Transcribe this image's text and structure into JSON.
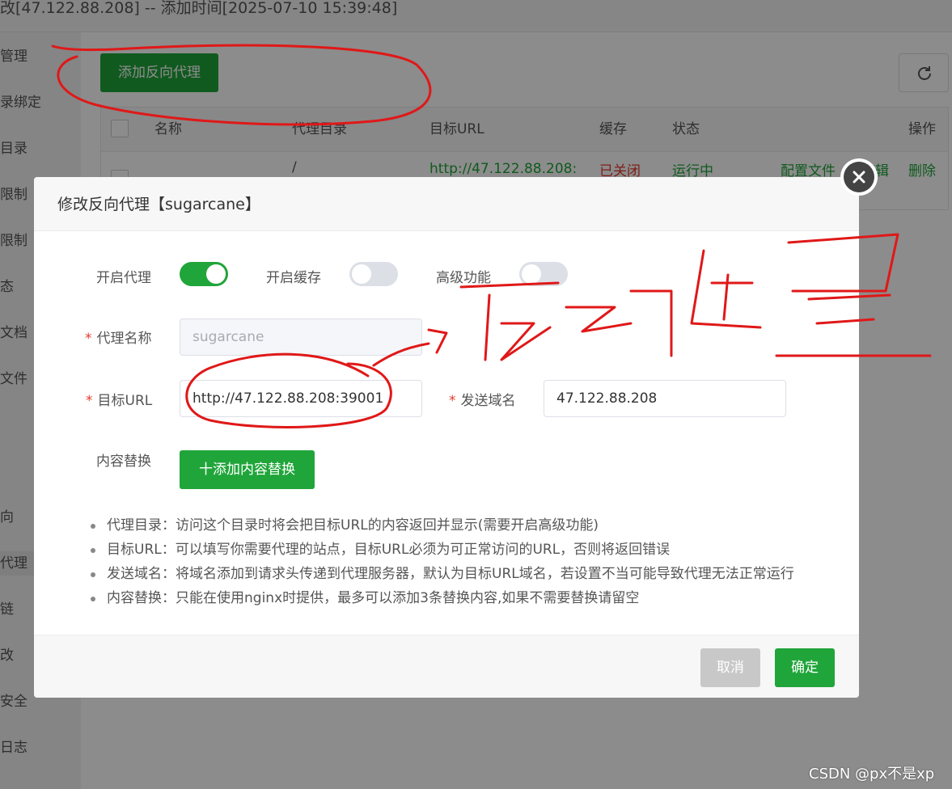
{
  "window": {
    "title": "改[47.122.88.208] -- 添加时间[2025-07-10 15:39:48]"
  },
  "sidebar": {
    "items": [
      {
        "label": "管理"
      },
      {
        "label": "录绑定"
      },
      {
        "label": "目录"
      },
      {
        "label": "限制"
      },
      {
        "label": "限制"
      },
      {
        "label": "态"
      },
      {
        "label": "文档"
      },
      {
        "label": "文件"
      },
      {
        "label": "向"
      },
      {
        "label": "代理"
      },
      {
        "label": "链"
      },
      {
        "label": "改"
      },
      {
        "label": "安全"
      },
      {
        "label": "日志"
      }
    ]
  },
  "toolbar": {
    "add_proxy_label": "添加反向代理",
    "refresh_icon": "refresh-icon"
  },
  "table": {
    "headers": {
      "name": "名称",
      "dir": "代理目录",
      "url": "目标URL",
      "cache": "缓存",
      "status": "状态",
      "ops": "操作"
    },
    "row": {
      "dir": "/",
      "url": "http://47.122.88.208:",
      "cache": "已关闭",
      "status": "运行中",
      "config": "配置文件",
      "edit": "编辑",
      "delete": "删除"
    }
  },
  "modal": {
    "title": "修改反向代理【sugarcane】",
    "enable_proxy_label": "开启代理",
    "enable_proxy": true,
    "enable_cache_label": "开启缓存",
    "enable_cache": false,
    "advanced_label": "高级功能",
    "advanced": false,
    "proxy_name_label": "代理名称",
    "proxy_name_value": "sugarcane",
    "target_url_label": "目标URL",
    "target_url_value": "http://47.122.88.208:39001",
    "send_domain_label": "发送域名",
    "send_domain_value": "47.122.88.208",
    "content_replace_label": "内容替换",
    "add_replace_label": "十添加内容替换",
    "tips": [
      "代理目录：访问这个目录时将会把目标URL的内容返回并显示(需要开启高级功能)",
      "目标URL：可以填写你需要代理的站点，目标URL必须为可正常访问的URL，否则将返回错误",
      "发送域名：将域名添加到请求头传递到代理服务器，默认为目标URL域名，若设置不当可能导致代理无法正常运行",
      "内容替换：只能在使用nginx时提供，最多可以添加3条替换内容,如果不需要替换请留空"
    ],
    "cancel_label": "取消",
    "ok_label": "确定"
  },
  "watermark": "CSDN @px不是xp",
  "colors": {
    "accent": "#20a53a",
    "required": "#e6392a",
    "annotation": "#e01818"
  }
}
